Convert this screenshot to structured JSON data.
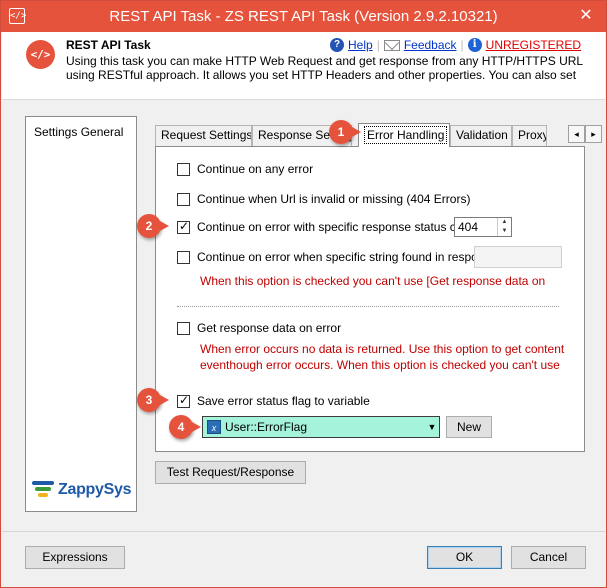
{
  "window": {
    "title": "REST API Task - ZS REST API Task (Version 2.9.2.10321)",
    "close_glyph": "✕",
    "accent": "#e5533d"
  },
  "header": {
    "title": "REST API Task",
    "description": "Using this task you can make HTTP Web Request and get response from any HTTP/HTTPS URL using RESTful approach. It allows you set HTTP Headers and other properties. You can also set",
    "help_label": "Help",
    "feedback_label": "Feedback",
    "unregistered_label": "UNREGISTERED",
    "separator": "|"
  },
  "sidebar": {
    "items": [
      {
        "label": "Settings General"
      }
    ],
    "brand": "ZappySys"
  },
  "tabs": [
    {
      "label": "Request Settings",
      "active": false
    },
    {
      "label": "Response Settings",
      "active": false
    },
    {
      "label": "Error Handling",
      "active": true
    },
    {
      "label": "Validation",
      "active": false
    },
    {
      "label": "Proxy",
      "active": false
    }
  ],
  "tab_scroll": {
    "left": "◂",
    "right": "▸"
  },
  "error_handling": {
    "continue_any_error": {
      "label": "Continue on any error",
      "checked": false
    },
    "continue_invalid_url": {
      "label": "Continue when Url is invalid or missing (404 Errors)",
      "checked": false
    },
    "continue_status_code": {
      "label": "Continue on error with specific response status code",
      "checked": true,
      "value": "404"
    },
    "continue_string_found": {
      "label": "Continue on error when specific string found in response",
      "checked": false,
      "warning": "When this option is checked you can't use [Get response data on error]"
    },
    "get_response_on_error": {
      "label": "Get response data on error",
      "checked": false,
      "warning_line1": "When error occurs no data is returned. Use this option to get content",
      "warning_line2": "eventhough error occurs. When this option is checked you can't use"
    },
    "save_status_flag": {
      "label": "Save error status flag to variable",
      "checked": true
    },
    "variable": {
      "value": "User::ErrorFlag",
      "icon_glyph": "x"
    },
    "new_button": "New"
  },
  "buttons": {
    "test": "Test Request/Response",
    "expressions": "Expressions",
    "ok": "OK",
    "cancel": "Cancel"
  },
  "callouts": [
    "1",
    "2",
    "3",
    "4"
  ]
}
